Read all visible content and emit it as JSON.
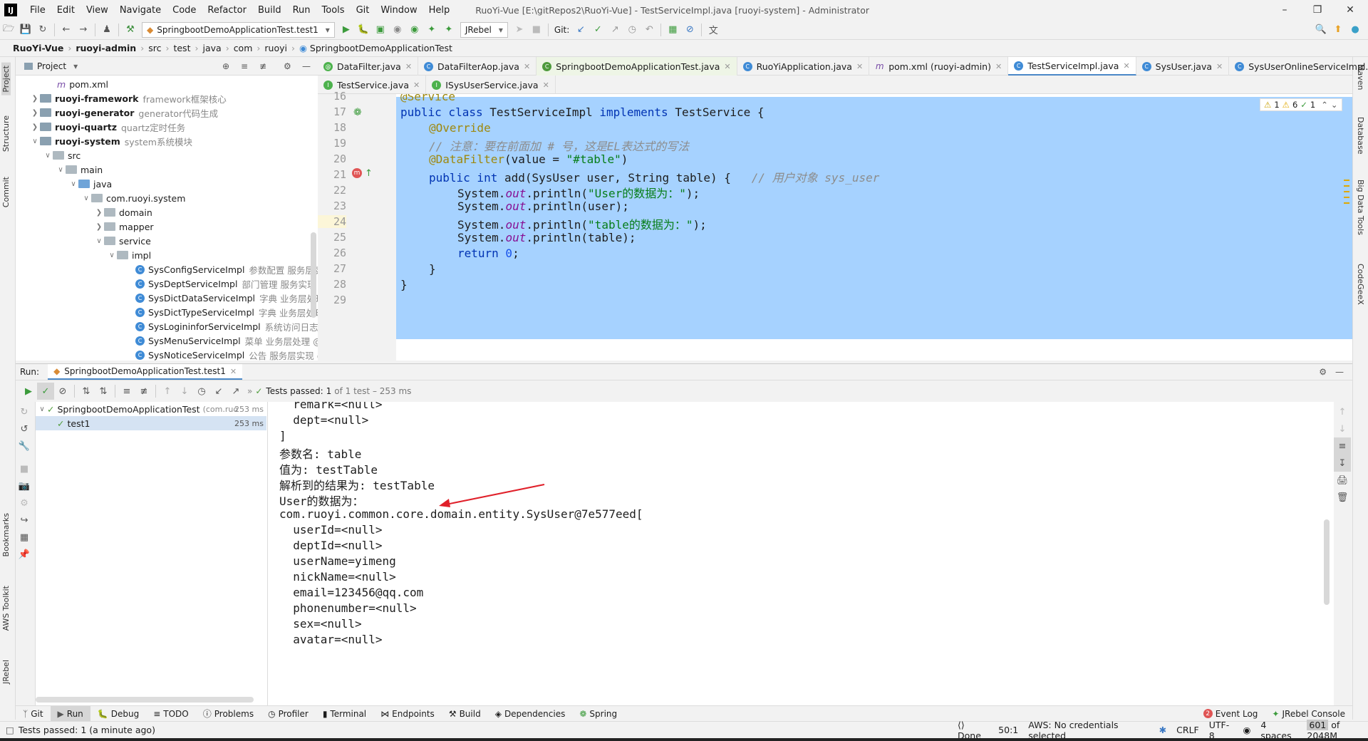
{
  "window": {
    "app_icon": "IJ",
    "menu": [
      "File",
      "Edit",
      "View",
      "Navigate",
      "Code",
      "Refactor",
      "Build",
      "Run",
      "Tools",
      "Git",
      "Window",
      "Help"
    ],
    "title": "RuoYi-Vue [E:\\gitRepos2\\RuoYi-Vue] - TestServiceImpl.java [ruoyi-system] - Administrator",
    "controls": [
      "–",
      "❐",
      "✕"
    ]
  },
  "toolbar": {
    "run_config": "SpringbootDemoApplicationTest.test1",
    "jrebel": "JRebel",
    "git_label": "Git:"
  },
  "breadcrumb": [
    "RuoYi-Vue",
    "ruoyi-admin",
    "src",
    "test",
    "java",
    "com",
    "ruoyi",
    "SpringbootDemoApplicationTest"
  ],
  "left_strip": [
    "Project",
    "Structure",
    "Commit",
    "Bookmarks",
    "AWS Toolkit",
    "JRebel"
  ],
  "right_strip": [
    "Maven",
    "Database",
    "Big Data Tools",
    "CodeGeeX"
  ],
  "project": {
    "title": "Project",
    "tree": [
      {
        "label": "pom.xml",
        "hint": "",
        "type": "pom"
      },
      {
        "label": "ruoyi-framework",
        "hint": "framework框架核心",
        "type": "module"
      },
      {
        "label": "ruoyi-generator",
        "hint": "generator代码生成",
        "type": "module"
      },
      {
        "label": "ruoyi-quartz",
        "hint": "quartz定时任务",
        "type": "module"
      },
      {
        "label": "ruoyi-system",
        "hint": "system系统模块",
        "type": "module"
      },
      {
        "label": "src",
        "hint": "",
        "type": "folder"
      },
      {
        "label": "main",
        "hint": "",
        "type": "folder"
      },
      {
        "label": "java",
        "hint": "",
        "type": "folder"
      },
      {
        "label": "com.ruoyi.system",
        "hint": "",
        "type": "package"
      },
      {
        "label": "domain",
        "hint": "",
        "type": "folder"
      },
      {
        "label": "mapper",
        "hint": "",
        "type": "folder"
      },
      {
        "label": "service",
        "hint": "",
        "type": "folder"
      },
      {
        "label": "impl",
        "hint": "",
        "type": "folder"
      },
      {
        "label": "SysConfigServiceImpl",
        "hint": "参数配置 服务层实现",
        "type": "class"
      },
      {
        "label": "SysDeptServiceImpl",
        "hint": "部门管理 服务实现",
        "type": "class"
      },
      {
        "label": "SysDictDataServiceImpl",
        "hint": "字典 业务层处理",
        "type": "class"
      },
      {
        "label": "SysDictTypeServiceImpl",
        "hint": "字典 业务层处理",
        "type": "class"
      },
      {
        "label": "SysLogininforServiceImpl",
        "hint": "系统访问日志情况",
        "type": "class"
      },
      {
        "label": "SysMenuServiceImpl",
        "hint": "菜单 业务层处理 @",
        "type": "class"
      },
      {
        "label": "SysNoticeServiceImpl",
        "hint": "公告 服务层实现 @",
        "type": "class"
      }
    ]
  },
  "editor_tabs_row1": [
    {
      "label": "DataFilter.java",
      "icon": "annotation-icon"
    },
    {
      "label": "DataFilterAop.java",
      "icon": "class-icon"
    },
    {
      "label": "SpringbootDemoApplicationTest.java",
      "icon": "test-class-icon"
    },
    {
      "label": "RuoYiApplication.java",
      "icon": "class-icon"
    },
    {
      "label": "pom.xml (ruoyi-admin)",
      "icon": "maven-icon"
    },
    {
      "label": "TestServiceImpl.java",
      "icon": "class-icon"
    },
    {
      "label": "SysUser.java",
      "icon": "class-icon"
    },
    {
      "label": "SysUserOnlineServiceImpl.java",
      "icon": "class-icon"
    }
  ],
  "editor_tabs_row2": [
    {
      "label": "TestService.java",
      "icon": "interface-icon"
    },
    {
      "label": "ISysUserService.java",
      "icon": "interface-icon"
    }
  ],
  "inspections": {
    "warn1": "1",
    "warn2": "6",
    "ok": "1"
  },
  "code": {
    "lines": [
      "16",
      "17",
      "18",
      "19",
      "20",
      "21",
      "22",
      "23",
      "24",
      "25",
      "26",
      "27",
      "28",
      "29"
    ],
    "l16": "@Service",
    "l17_kw": "public class",
    "l17_name": " TestServiceImpl ",
    "l17_impl": "implements",
    "l17_rest": " TestService {",
    "l18": "@Override",
    "l19": "// 注意：要在前面加 # 号，这是EL表达式的写法",
    "l20_ann": "@DataFilter",
    "l20_open": "(value = ",
    "l20_str": "\"#table\"",
    "l20_close": ")",
    "l21_kw": "public int",
    "l21_rest": " add(SysUser user, String table) {   ",
    "l21_cm": "// 用户对象 sys_user",
    "sys": "System.",
    "out": "out",
    "println": ".println(",
    "l22_str": "\"User的数据为：\"",
    "close_paren": ");",
    "l23_arg": "user",
    "l24_str": "\"table的数据为：\"",
    "l25_arg": "table",
    "l26_kw": "return",
    "l26_num": " 0",
    "l26_end": ";",
    "l27": "}",
    "l28": "}"
  },
  "run": {
    "label": "Run:",
    "tab": "SpringbootDemoApplicationTest.test1",
    "status": "Tests passed:",
    "status_count": "1",
    "status_detail": "of 1 test – 253 ms",
    "tree": [
      {
        "label": "SpringbootDemoApplicationTest",
        "hint": "(com.ruo",
        "time": "253 ms"
      },
      {
        "label": "test1",
        "hint": "",
        "time": "253 ms"
      }
    ],
    "console": [
      "  remark=<null>",
      "  dept=<null>",
      "]",
      "参数名: table",
      "值为: testTable",
      "解析到的结果为: testTable",
      "User的数据为：",
      "com.ruoyi.common.core.domain.entity.SysUser@7e577eed[",
      "  userId=<null>",
      "  deptId=<null>",
      "  userName=yimeng",
      "  nickName=<null>",
      "  email=123456@qq.com",
      "  phonenumber=<null>",
      "  sex=<null>",
      "  avatar=<null>"
    ]
  },
  "bottom_tabs": [
    "Git",
    "Run",
    "Debug",
    "TODO",
    "Problems",
    "Profiler",
    "Terminal",
    "Endpoints",
    "Build",
    "Dependencies",
    "Spring"
  ],
  "bottom_right": {
    "event_log": "Event Log",
    "event_count": "2",
    "jrebel_console": "JRebel Console"
  },
  "status": {
    "message": "Tests passed: 1 (a minute ago)",
    "done": "Done",
    "pos": "50:1",
    "aws": "AWS: No credentials selected",
    "crlf": "CRLF",
    "enc": "UTF-8",
    "indent": "4 spaces",
    "mem_used": "601",
    "mem_total": "of 2048M"
  },
  "colors": {
    "selection": "#a6d2ff",
    "keyword": "#0033b3",
    "annotation": "#9e880d",
    "string": "#067d17",
    "arrow": "#e0202a"
  }
}
